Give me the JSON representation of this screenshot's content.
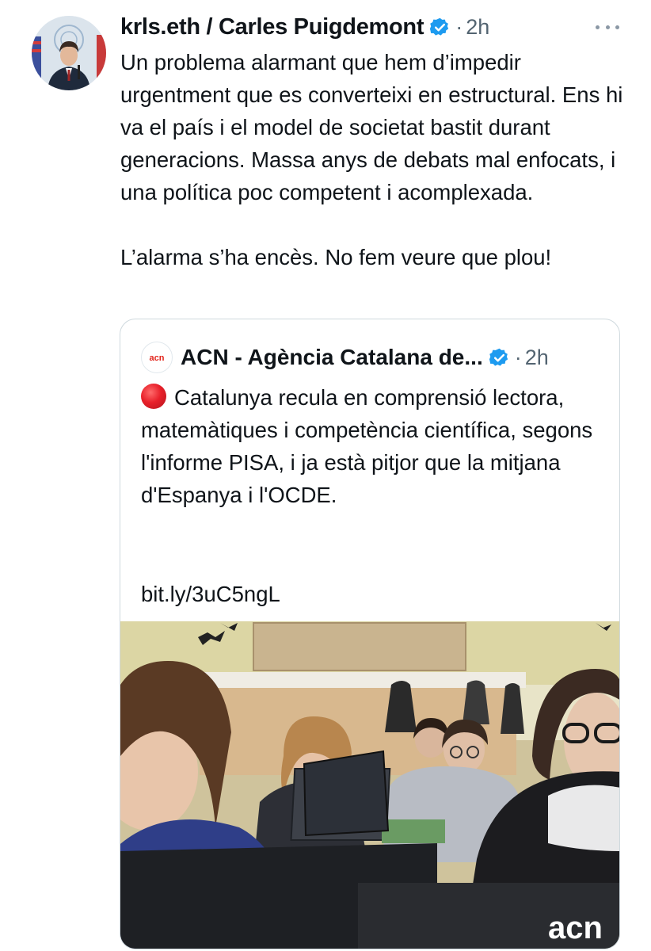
{
  "tweet": {
    "author_name": "krls.eth / Carles Puigdemont",
    "separator": "·",
    "time": "2h",
    "text_paragraph_1": "Un problema alarmant que hem d’impedir urgentment que es converteixi en estructural. Ens hi va el país i el model de societat bastit durant generacions. Massa anys de debats mal enfocats, i una política poc competent i acomplexada.",
    "text_paragraph_2": "L’alarma s’ha encès. No fem veure que plou!"
  },
  "quoted": {
    "logo_text": "acn",
    "author_name": "ACN - Agència Catalana de...",
    "separator": "·",
    "time": "2h",
    "emoji": "red-circle",
    "text": "Catalunya recula en comprensió lectora, matemàtiques i competència científica, segons l'informe PISA, i ja està pitjor que la mitjana d'Espanya i l'OCDE.",
    "link": "bit.ly/3uC5ngL",
    "image_watermark": "acn"
  },
  "colors": {
    "verified_blue": "#1d9bf0",
    "secondary_text": "#536471",
    "acn_red": "#e2231a",
    "border": "#cfd9de"
  },
  "icons": [
    "verified-badge-icon",
    "more-options-icon",
    "red-circle-emoji"
  ]
}
